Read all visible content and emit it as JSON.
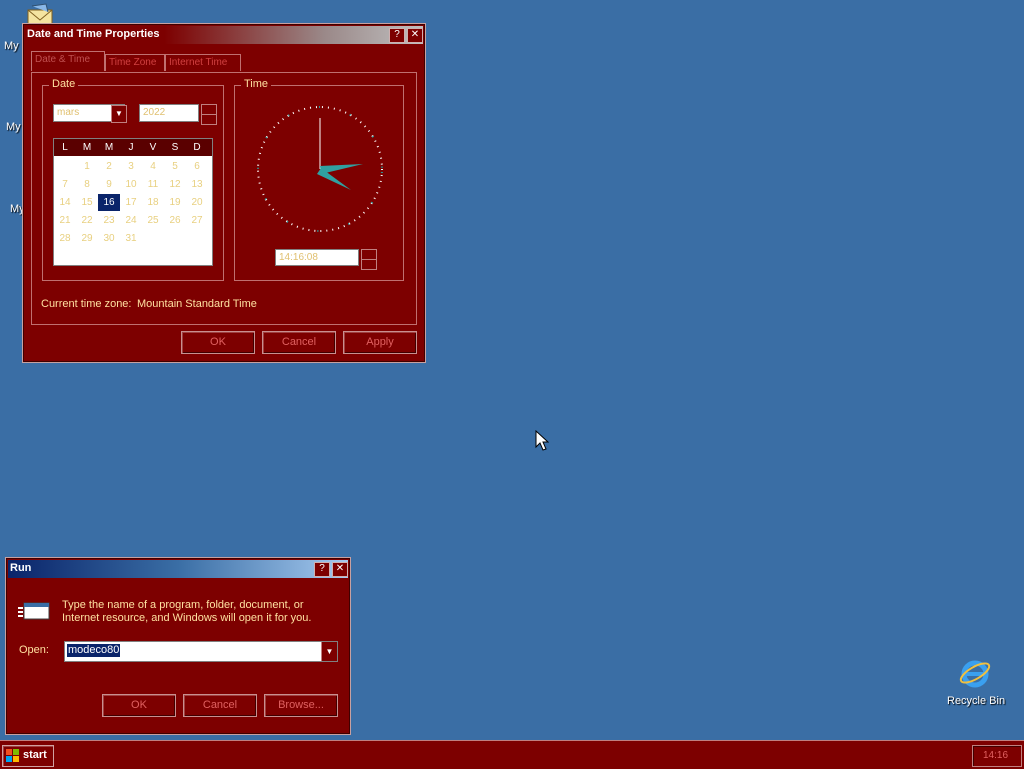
{
  "desktop": {
    "icons": [
      {
        "label": "My I"
      },
      {
        "label": "My"
      },
      {
        "label": "My"
      },
      {
        "label": "Recycle Bin"
      }
    ]
  },
  "dt_window": {
    "title": "Date and Time Properties",
    "tabs": [
      "Date & Time",
      "Time Zone",
      "Internet Time"
    ],
    "date_group": "Date",
    "time_group": "Time",
    "month": "mars",
    "year": "2022",
    "weekdays": [
      "L",
      "M",
      "M",
      "J",
      "V",
      "S",
      "D"
    ],
    "days": [
      "1",
      "2",
      "3",
      "4",
      "5",
      "6",
      "7",
      "8",
      "9",
      "10",
      "11",
      "12",
      "13",
      "14",
      "15",
      "16",
      "17",
      "18",
      "19",
      "20",
      "21",
      "22",
      "23",
      "24",
      "25",
      "26",
      "27",
      "28",
      "29",
      "30",
      "31"
    ],
    "selected_day": "16",
    "time_value": "14:16:08",
    "timezone_label": "Current time zone:",
    "timezone_value": "Mountain Standard Time",
    "buttons": {
      "ok": "OK",
      "cancel": "Cancel",
      "apply": "Apply"
    }
  },
  "run_window": {
    "title": "Run",
    "description_line1": "Type the name of a program, folder, document, or",
    "description_line2": "Internet resource, and Windows will open it for you.",
    "open_label": "Open:",
    "open_value": "modeco80",
    "buttons": {
      "ok": "OK",
      "cancel": "Cancel",
      "browse": "Browse..."
    }
  },
  "taskbar": {
    "start_label": "start",
    "clock": "14:16"
  },
  "colors": {
    "desktop_bg": "#3a6ea5",
    "window_bg": "#7d0000",
    "accent_text": "#ffe0a0"
  }
}
